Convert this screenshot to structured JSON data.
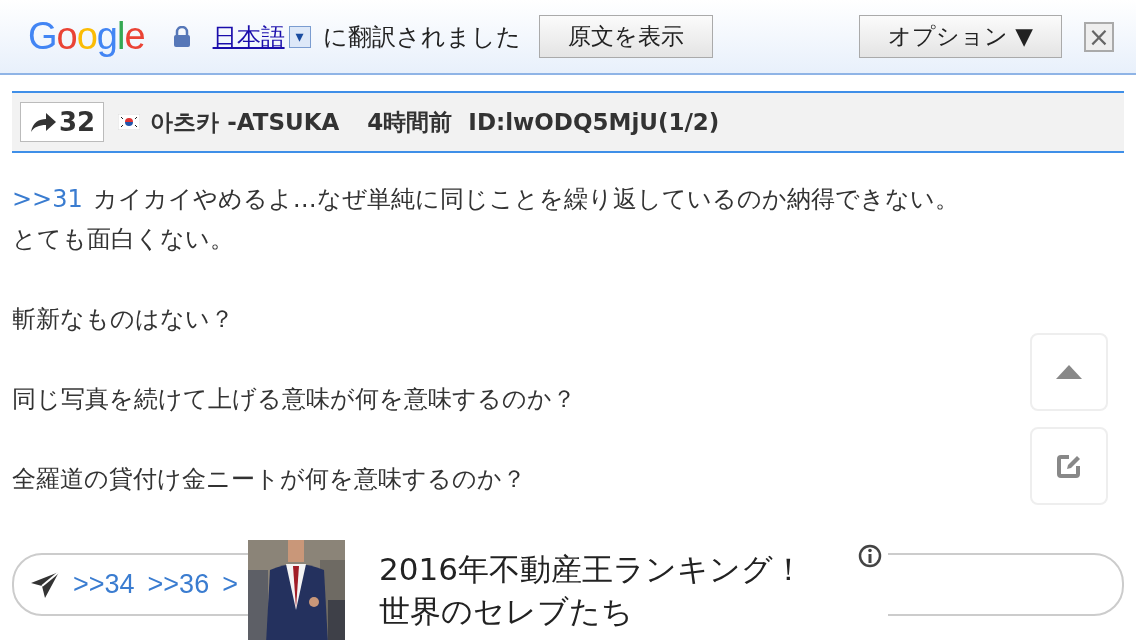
{
  "translate_bar": {
    "logo": "Google",
    "language": "日本語",
    "language_dropdown": "▾",
    "message": "に翻訳されました",
    "show_original": "原文を表示",
    "options": "オプション ▼",
    "close": "×"
  },
  "post": {
    "reply_count": "32",
    "author": "아츠카 -ATSUKA",
    "time": "4時間前",
    "id": "ID:lwODQ5MjU(1/2)",
    "paragraphs": [
      {
        "anchor": ">>31",
        "lines": [
          "カイカイやめるよ…なぜ単純に同じことを繰り返しているのか納得できない。",
          "とても面白くない。"
        ]
      },
      {
        "lines": [
          "斬新なものはない？"
        ]
      },
      {
        "lines": [
          "同じ写真を続けて上げる意味が何を意味するのか？"
        ]
      },
      {
        "lines": [
          "全羅道の貸付け金ニートが何を意味するのか？"
        ]
      }
    ]
  },
  "reply_bar": {
    "links": [
      ">>34",
      ">>36",
      ">"
    ]
  },
  "ad": {
    "kind": "picture",
    "headline_lines": [
      "2016年不動産王ランキング！",
      "世界のセレブたち"
    ]
  }
}
